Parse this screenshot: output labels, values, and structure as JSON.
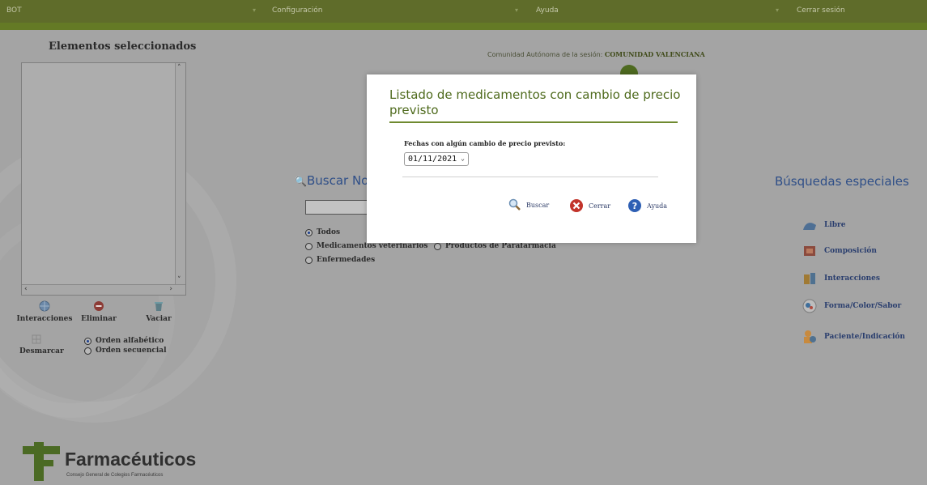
{
  "topbar": {
    "items": [
      "BOT",
      "Configuración",
      "Ayuda",
      "Cerrar sesión"
    ]
  },
  "sidebar": {
    "title": "Elementos seleccionados",
    "tools": [
      "Interacciones",
      "Eliminar",
      "Vaciar",
      "Desmarcar"
    ],
    "order_options": [
      "Orden alfabético",
      "Orden secuencial"
    ]
  },
  "logo": {
    "name": "Farmacéuticos",
    "subtitle": "Consejo General de Colegios Farmacéuticos"
  },
  "main": {
    "community_label": "Comunidad Autónoma de la sesión:",
    "community_value": "COMUNIDAD VALENCIANA",
    "search_title": "Buscar No",
    "search_value": "",
    "options": [
      "Todos",
      "Medicamentos veterinarios",
      "Productos de Parafarmacia",
      "Enfermedades"
    ]
  },
  "special": {
    "title": "Búsquedas especiales",
    "items": [
      "Libre",
      "Composición",
      "Interacciones",
      "Forma/Color/Sabor",
      "Paciente/Indicación"
    ]
  },
  "modal": {
    "title": "Listado de medicamentos con cambio de precio previsto",
    "label": "Fechas con algún cambio de precio previsto:",
    "selected_date": "01/11/2021",
    "buttons": [
      "Buscar",
      "Cerrar",
      "Ayuda"
    ]
  },
  "colors": {
    "topbar": "#5f6c2a",
    "accent_green": "#4e6a1c",
    "link_blue": "#2f4f88",
    "overlay_grey": "#a4a4a4"
  }
}
